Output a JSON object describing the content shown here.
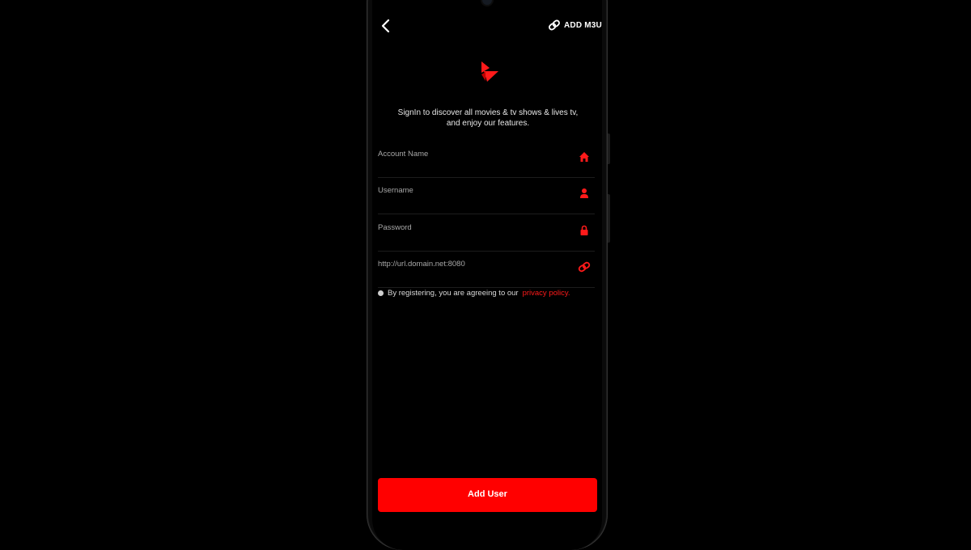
{
  "header": {
    "back_icon": "chevron-left-icon",
    "add_m3u_label": "ADD M3U",
    "add_m3u_icon": "link-icon"
  },
  "logo": {
    "icon": "play-logo-icon",
    "color": "#ff1a1a"
  },
  "tagline": {
    "line1": "SignIn to discover all movies & tv shows & lives tv,",
    "line2": "and enjoy our features."
  },
  "form": {
    "fields": [
      {
        "label": "Account Name",
        "icon": "home-icon"
      },
      {
        "label": "Username",
        "icon": "user-icon"
      },
      {
        "label": "Password",
        "icon": "lock-icon"
      },
      {
        "label": "http://url.domain.net:8080",
        "icon": "link-icon"
      }
    ]
  },
  "policy": {
    "text": "By registering, you are agreeing to our",
    "link": "privacy policy."
  },
  "submit": {
    "label": "Add User",
    "color": "#ff0000"
  },
  "colors": {
    "accent": "#ff1a1a",
    "background": "#000000",
    "field_label": "#a8a8a8"
  }
}
